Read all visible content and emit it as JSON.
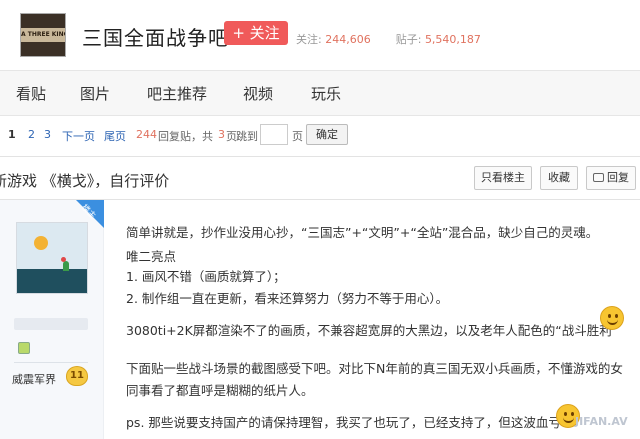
{
  "header": {
    "logo_text": "A THREE KINGDOMS",
    "forum_name": "三国全面战争吧",
    "follow_label": "+ 关注",
    "follow_count_label": "关注:",
    "follow_count": "244,606",
    "post_count_label": "贴子:",
    "post_count": "5,540,187"
  },
  "nav": {
    "items": [
      "看贴",
      "图片",
      "吧主推荐",
      "视频",
      "玩乐"
    ]
  },
  "pager": {
    "current": "1",
    "pages": [
      "2",
      "3"
    ],
    "next": "下一页",
    "last": "尾页",
    "reply_count": "244",
    "reply_label": "回复贴，共",
    "total_pages": "3",
    "pages_label": "页",
    "jump_label": "跳到",
    "page_unit": "页",
    "confirm": "确定"
  },
  "thread": {
    "title": "新游戏 《横戈》，自行评价",
    "only_op": "只看楼主",
    "favorite": "收藏",
    "reply": "回复"
  },
  "author": {
    "op_badge": "楼主",
    "name": "威震军界",
    "level": "11"
  },
  "post": {
    "lines": [
      "简单讲就是，抄作业没用心抄，“三国志”+“文明”+“全站”混合品，缺少自己的灵魂。",
      "唯二亮点",
      "1. 画风不错（画质就算了）；",
      "2. 制作组一直在更新，看来还算努力（努力不等于用心）。",
      "3080ti+2K屏都渲染不了的画质，不兼容超宽屏的大黑边，以及老年人配色的“战斗胜利”",
      "下面贴一些战斗场景的截图感受下吧。对比下N年前的真三国无双小兵画质，不懂游戏的女",
      "同事看了都直呼是糊糊的纸片人。",
      "ps. 那些说要支持国产的请保持理智，我买了也玩了，已经支持了，但这波血亏"
    ]
  },
  "watermark": "JIFAN.AV"
}
